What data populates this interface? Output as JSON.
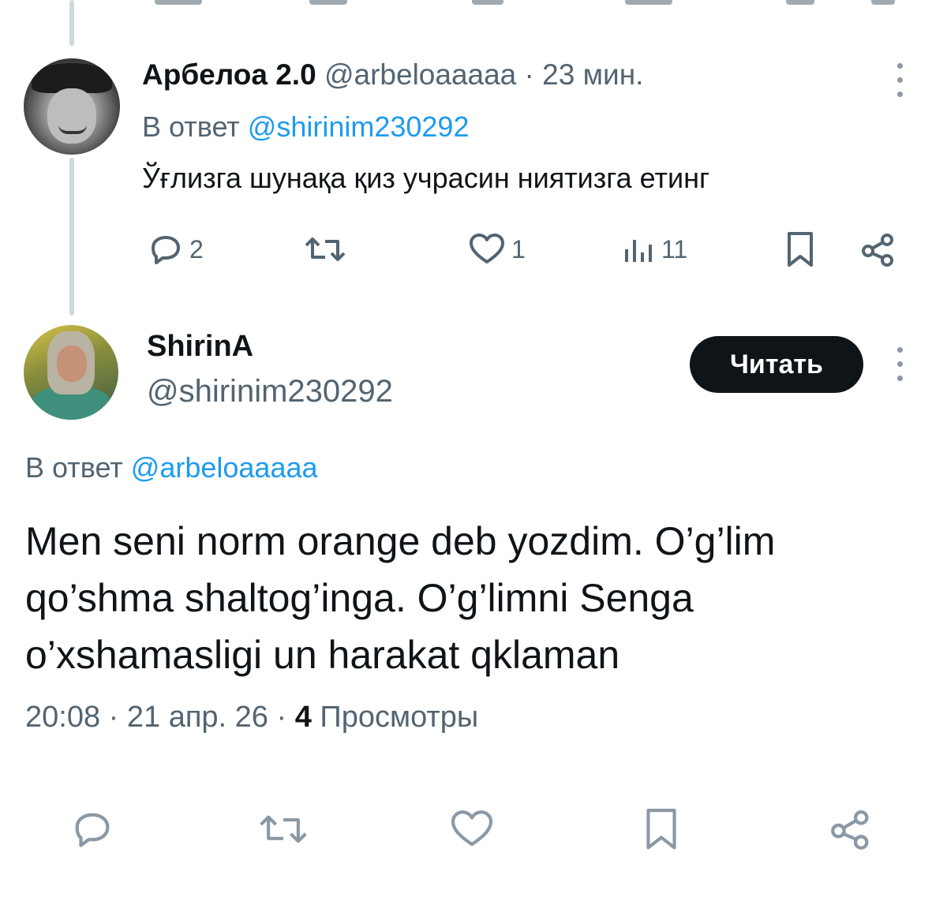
{
  "reply": {
    "name": "Арбелоа 2.0",
    "handle": "@arbeloaaaaa",
    "time": "· 23 мин.",
    "reply_prefix": "В ответ ",
    "reply_mention": "@shirinim230292",
    "text": "Ўғлизга шунақа қиз учрасин ниятизга етинг",
    "actions": {
      "replies": "2",
      "retweets": "",
      "likes": "1",
      "views": "11"
    }
  },
  "main": {
    "name": "ShirinA",
    "handle": "@shirinim230292",
    "follow_label": "Читать",
    "reply_prefix": "В ответ ",
    "reply_mention": "@arbeloaaaaa",
    "text": "Men seni norm orange deb yozdim. O’g’lim qo’shma shaltog’inga. O’g’limni Senga o’xshamasligi un harakat qklaman",
    "timestamp": "20:08 · 21 апр. 26 · ",
    "views_count": "4",
    "views_label": " Просмотры"
  },
  "icons": {
    "reply": "reply-icon",
    "retweet": "retweet-icon",
    "like": "heart-icon",
    "views": "views-icon",
    "bookmark": "bookmark-icon",
    "share": "share-icon",
    "more": "more-vertical-icon"
  },
  "colors": {
    "link": "#1d9bf0",
    "secondary": "#536471",
    "button_bg": "#0f1419"
  }
}
